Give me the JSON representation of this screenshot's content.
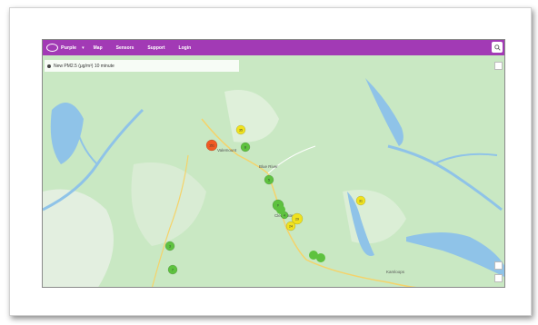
{
  "header": {
    "brand": "Purple",
    "nav": [
      "Map",
      "Sensors",
      "Support",
      "Login"
    ]
  },
  "status_bar": {
    "text": "New PM2.5 (μg/m³) 10 minute"
  },
  "map_labels": [
    "Valemount",
    "Blue River",
    "Clearwater",
    "Kamloops"
  ],
  "colors": {
    "header": "#a23ab5",
    "land": "#c9e8c3",
    "water": "#8fc3e8",
    "sensor_good": "#5ec23f",
    "sensor_moderate": "#f0e21e",
    "sensor_unhealthy": "#f05a24"
  },
  "sensors": [
    {
      "id": "s1",
      "level": "unhealthy",
      "value": "151"
    },
    {
      "id": "s2",
      "level": "moderate",
      "value": "35"
    },
    {
      "id": "s3",
      "level": "good",
      "value": "8"
    },
    {
      "id": "s4",
      "level": "good",
      "value": "5"
    },
    {
      "id": "s5",
      "level": "good",
      "value": "6"
    },
    {
      "id": "s6",
      "level": "moderate",
      "value": "29"
    },
    {
      "id": "s7",
      "level": "moderate",
      "value": "24"
    },
    {
      "id": "s8",
      "level": "good",
      "value": "4"
    },
    {
      "id": "s9",
      "level": "good",
      "value": "3"
    },
    {
      "id": "s10",
      "level": "good",
      "value": "7"
    },
    {
      "id": "s11",
      "level": "moderate",
      "value": "31"
    }
  ]
}
